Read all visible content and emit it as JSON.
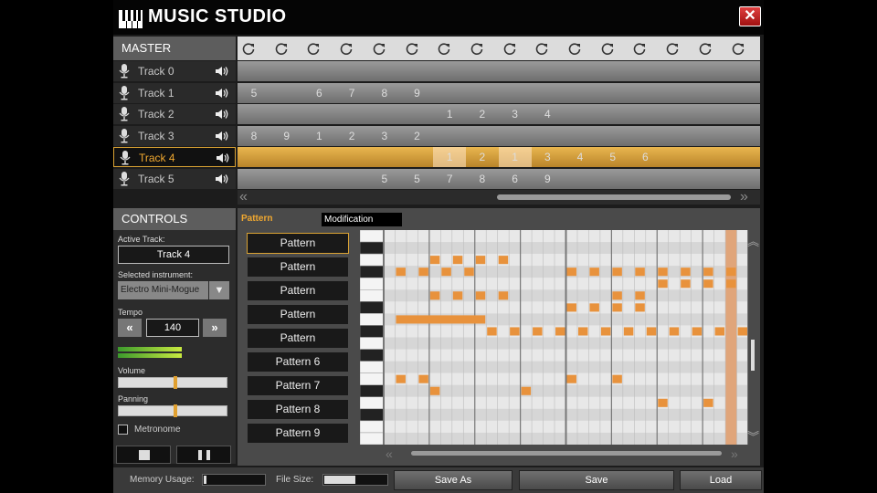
{
  "app": {
    "title": "MUSIC STUDIO",
    "close_label": "✕"
  },
  "master": {
    "label": "MASTER",
    "loop_count": 16
  },
  "tracks": [
    {
      "name": "Track 0",
      "steps": []
    },
    {
      "name": "Track 1",
      "steps": [
        [
          0,
          "5"
        ],
        [
          2,
          "6"
        ],
        [
          3,
          "7"
        ],
        [
          4,
          "8"
        ],
        [
          5,
          "9"
        ]
      ]
    },
    {
      "name": "Track 2",
      "steps": [
        [
          6,
          "1"
        ],
        [
          7,
          "2"
        ],
        [
          8,
          "3"
        ],
        [
          9,
          "4"
        ]
      ]
    },
    {
      "name": "Track 3",
      "steps": [
        [
          0,
          "8"
        ],
        [
          1,
          "9"
        ],
        [
          2,
          "1"
        ],
        [
          3,
          "2"
        ],
        [
          4,
          "3"
        ],
        [
          5,
          "2"
        ]
      ]
    },
    {
      "name": "Track 4",
      "active": true,
      "steps": [
        [
          6,
          "1"
        ],
        [
          7,
          "2"
        ],
        [
          8,
          "1"
        ],
        [
          9,
          "3"
        ],
        [
          10,
          "4"
        ],
        [
          11,
          "5"
        ],
        [
          12,
          "6"
        ]
      ],
      "highlight": [
        6,
        8
      ]
    },
    {
      "name": "Track 5",
      "steps": [
        [
          4,
          "5"
        ],
        [
          5,
          "5"
        ],
        [
          6,
          "7"
        ],
        [
          7,
          "8"
        ],
        [
          8,
          "6"
        ],
        [
          9,
          "9"
        ]
      ]
    }
  ],
  "controls": {
    "header": "CONTROLS",
    "active_track_label": "Active Track:",
    "active_track": "Track 4",
    "instrument_label": "Selected instrument:",
    "instrument": "Electro Mini-Mogue",
    "tempo_label": "Tempo",
    "tempo": "140",
    "tempo_down": "«",
    "tempo_up": "»",
    "volume_label": "Volume",
    "volume_level": 0.52,
    "panning_label": "Panning",
    "panning_level": 0.52,
    "metronome_label": "Metronome"
  },
  "pattern_editor": {
    "tab_pattern": "Pattern",
    "tab_modification": "Modification",
    "patterns": [
      "Pattern",
      "Pattern",
      "Pattern",
      "Pattern",
      "Pattern",
      "Pattern 6",
      "Pattern 7",
      "Pattern 8",
      "Pattern 9"
    ],
    "selected_pattern": 0
  },
  "bottom": {
    "memory_label": "Memory Usage:",
    "memory_level": 0.05,
    "file_size_label": "File Size:",
    "file_size_level": 0.5,
    "save_as": "Save As",
    "save": "Save",
    "load": "Load"
  },
  "colors": {
    "accent": "#f0a830",
    "note": "#e8923c"
  }
}
